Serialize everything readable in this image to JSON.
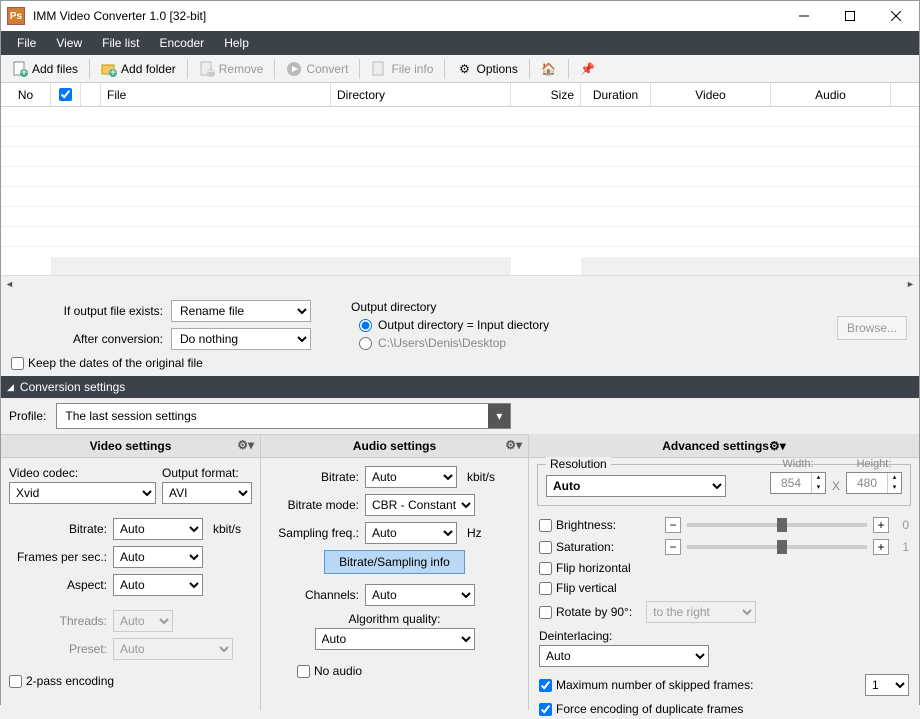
{
  "window": {
    "title": "IMM Video Converter 1.0  [32-bit]",
    "icon_text": "Ps"
  },
  "menu": [
    "File",
    "View",
    "File list",
    "Encoder",
    "Help"
  ],
  "toolbar": {
    "add_files": "Add files",
    "add_folder": "Add folder",
    "remove": "Remove",
    "convert": "Convert",
    "file_info": "File info",
    "options": "Options"
  },
  "columns": {
    "no": "No",
    "chk": "☑",
    "file": "File",
    "directory": "Directory",
    "size": "Size",
    "duration": "Duration",
    "video": "Video",
    "audio": "Audio"
  },
  "mid": {
    "if_exists_label": "If output file exists:",
    "if_exists_value": "Rename file",
    "after_conv_label": "After conversion:",
    "after_conv_value": "Do nothing",
    "keep_dates": "Keep the dates of the original file",
    "output_dir_label": "Output directory",
    "out_eq_in": "Output directory = Input diectory",
    "out_path": "C:\\Users\\Denis\\Desktop",
    "browse": "Browse..."
  },
  "section_title": "Conversion settings",
  "profile": {
    "label": "Profile:",
    "value": "The last session settings"
  },
  "video": {
    "title": "Video settings",
    "codec_label": "Video codec:",
    "codec_value": "Xvid",
    "format_label": "Output format:",
    "format_value": "AVI",
    "bitrate_label": "Bitrate:",
    "bitrate_value": "Auto",
    "bitrate_unit": "kbit/s",
    "fps_label": "Frames per sec.:",
    "fps_value": "Auto",
    "aspect_label": "Aspect:",
    "aspect_value": "Auto",
    "threads_label": "Threads:",
    "threads_value": "Auto",
    "preset_label": "Preset:",
    "preset_value": "Auto",
    "two_pass": "2-pass encoding"
  },
  "audio": {
    "title": "Audio settings",
    "bitrate_label": "Bitrate:",
    "bitrate_value": "Auto",
    "bitrate_unit": "kbit/s",
    "mode_label": "Bitrate mode:",
    "mode_value": "CBR - Constant",
    "freq_label": "Sampling freq.:",
    "freq_value": "Auto",
    "freq_unit": "Hz",
    "info_btn": "Bitrate/Sampling info",
    "channels_label": "Channels:",
    "channels_value": "Auto",
    "algo_label": "Algorithm quality:",
    "algo_value": "Auto",
    "no_audio": "No audio"
  },
  "advanced": {
    "title": "Advanced settings",
    "resolution": "Resolution",
    "res_value": "Auto",
    "width_label": "Width:",
    "width_value": "854",
    "height_label": "Height:",
    "height_value": "480",
    "x": "X",
    "brightness": "Brightness:",
    "brightness_val": "0",
    "saturation": "Saturation:",
    "saturation_val": "1",
    "flip_h": "Flip horizontal",
    "flip_v": "Flip vertical",
    "rotate": "Rotate by 90°:",
    "rotate_dir": "to the right",
    "deint_label": "Deinterlacing:",
    "deint_value": "Auto",
    "max_skipped": "Maximum number of skipped frames:",
    "max_skipped_val": "1",
    "force_dup": "Force encoding of duplicate frames"
  }
}
